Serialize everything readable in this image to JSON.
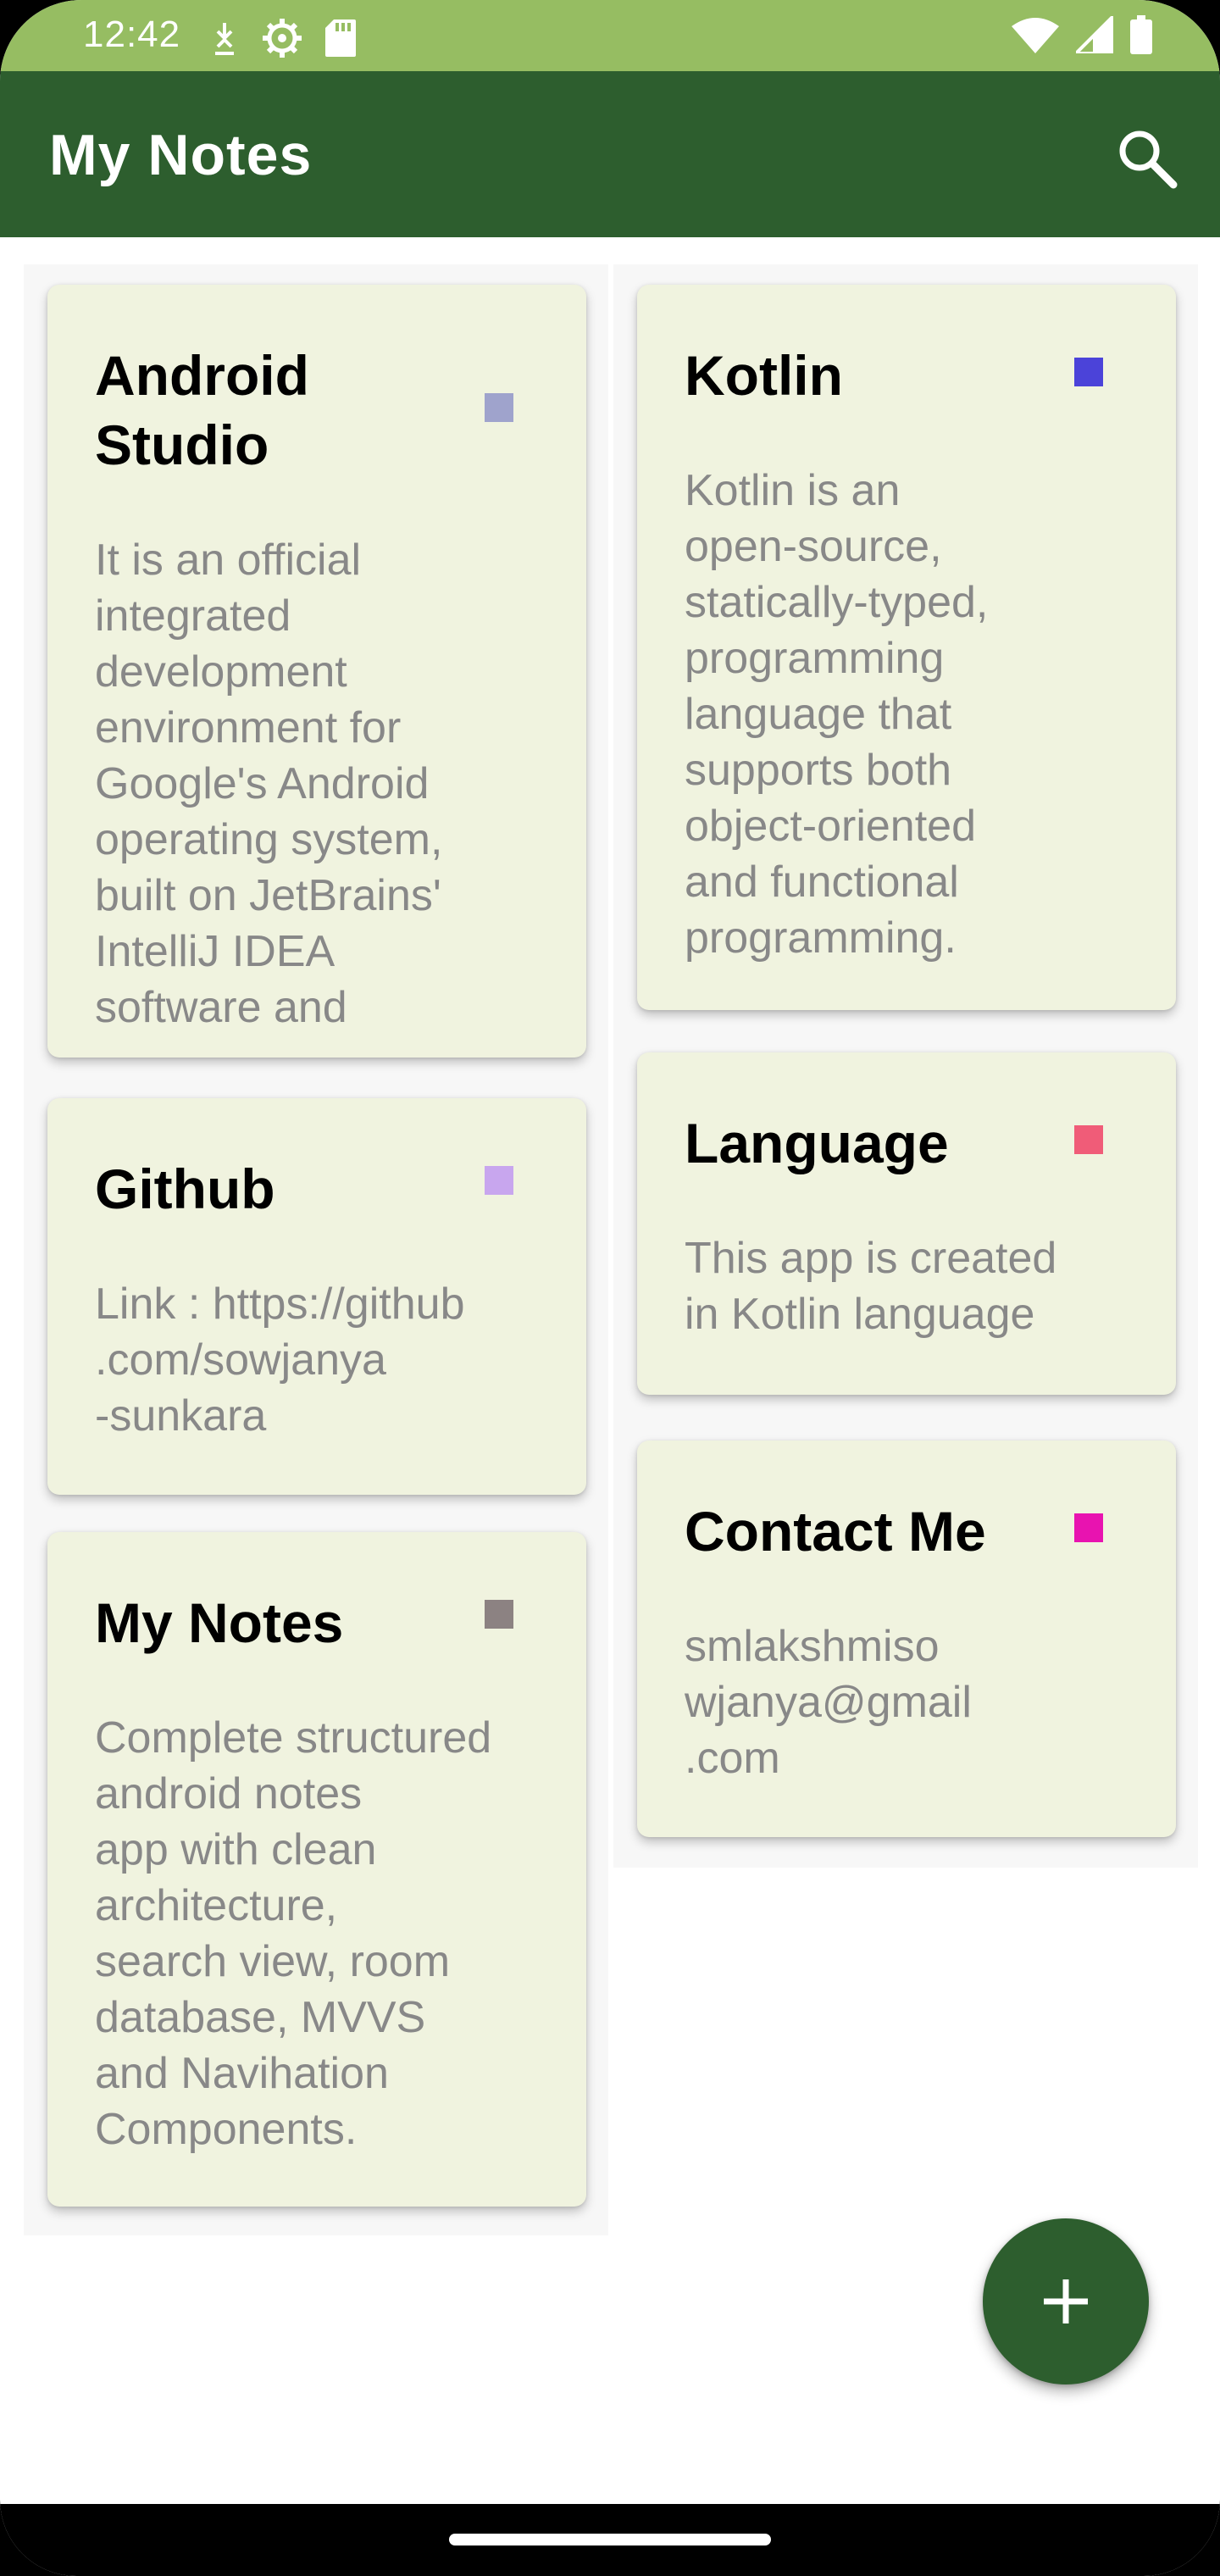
{
  "status_bar": {
    "time": "12:42",
    "left_icons": [
      "download-icon",
      "settings-icon",
      "sd-card-icon"
    ],
    "right_icons": [
      "wifi-icon",
      "cell-signal-icon",
      "battery-icon"
    ],
    "color": "#96bd62"
  },
  "app_bar": {
    "title": "My Notes",
    "search_icon": "search-icon",
    "color": "#2d5e2e"
  },
  "notes_left": [
    {
      "title": "Android\nStudio",
      "body": "It is an official\nintegrated\ndevelopment\nenvironment for\nGoogle's Android\noperating system,\nbuilt on JetBrains'\nIntelliJ IDEA\nsoftware and",
      "color": "#9fa3cc"
    },
    {
      "title": "Github",
      "body": "Link : https://github\n.com/sowjanya\n-sunkara",
      "color": "#c8a6ee"
    },
    {
      "title": "My Notes",
      "body": "Complete structured\nandroid notes\napp with clean\narchitecture,\nsearch view, room\ndatabase, MVVS\nand Navihation\nComponents.",
      "color": "#8c8282"
    }
  ],
  "notes_right": [
    {
      "title": "Kotlin",
      "body": "Kotlin is an\nopen-source,\nstatically-typed,\nprogramming\nlanguage that\nsupports both\nobject-oriented\nand functional\nprogramming.",
      "color": "#4b43d9"
    },
    {
      "title": "Language",
      "body": "This app is created\nin Kotlin language",
      "color": "#f05c78"
    },
    {
      "title": "Contact Me",
      "body": "smlakshmiso\nwjanya@gmail\n.com",
      "color": "#e813b0"
    }
  ],
  "fab": {
    "icon": "plus-icon",
    "color": "#2d5e2e"
  },
  "card_background": "#f0f3df"
}
